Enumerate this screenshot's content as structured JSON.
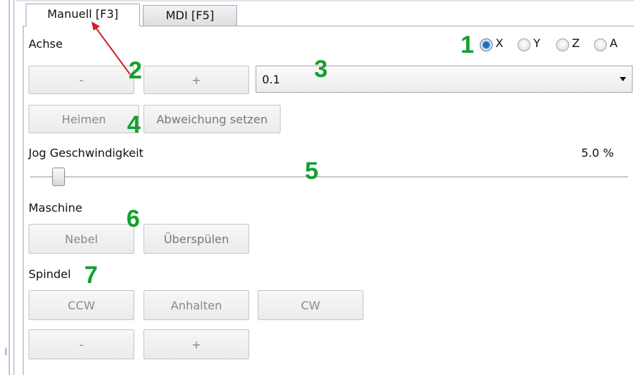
{
  "tabs": [
    {
      "label": "Manuell [F3]",
      "active": true
    },
    {
      "label": "MDI [F5]",
      "active": false
    }
  ],
  "axis": {
    "label": "Achse",
    "options": [
      "X",
      "Y",
      "Z",
      "A"
    ],
    "selected": "X",
    "minus_label": "-",
    "plus_label": "+",
    "step_value": "0.1"
  },
  "homing": {
    "home_label": "Heimen",
    "offset_label": "Abweichung setzen"
  },
  "jog": {
    "label": "Jog Geschwindigkeit",
    "value_text": "5.0 %",
    "value_fraction": 0.05
  },
  "machine": {
    "label": "Maschine",
    "mist_label": "Nebel",
    "flood_label": "Überspülen"
  },
  "spindle": {
    "label": "Spindel",
    "ccw_label": "CCW",
    "stop_label": "Anhalten",
    "cw_label": "CW",
    "minus_label": "-",
    "plus_label": "+"
  },
  "annotations": [
    "1",
    "2",
    "3",
    "4",
    "5",
    "6",
    "7"
  ],
  "colors": {
    "annotation": "#13a02e",
    "arrow": "#d0202a",
    "radio_selected": "#1f6fb6"
  }
}
